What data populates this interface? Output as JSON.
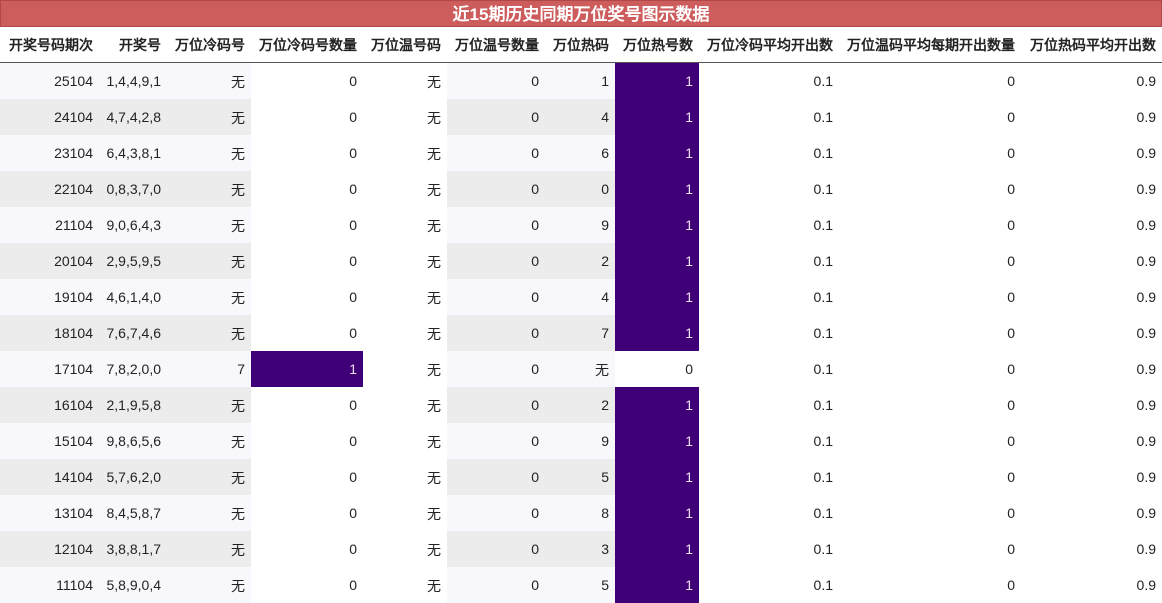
{
  "title": "近15期历史同期万位奖号图示数据",
  "colors": {
    "title_bg": "#cd5c5c",
    "highlight": "#3f0077"
  },
  "columns": [
    "开奖号码期次",
    "开奖号",
    "万位冷码号",
    "万位冷码号数量",
    "万位温号码",
    "万位温号数量",
    "万位热码",
    "万位热号数",
    "万位冷码平均开出数",
    "万位温码平均每期开出数量",
    "万位热码平均开出数"
  ],
  "rows": [
    {
      "issue": "25104",
      "numbers": "1,4,4,9,1",
      "cold": "无",
      "cold_count": "0",
      "warm": "无",
      "warm_count": "0",
      "hot": "1",
      "hot_count": "1",
      "cold_avg": "0.1",
      "warm_avg": "0",
      "hot_avg": "0.9"
    },
    {
      "issue": "24104",
      "numbers": "4,7,4,2,8",
      "cold": "无",
      "cold_count": "0",
      "warm": "无",
      "warm_count": "0",
      "hot": "4",
      "hot_count": "1",
      "cold_avg": "0.1",
      "warm_avg": "0",
      "hot_avg": "0.9"
    },
    {
      "issue": "23104",
      "numbers": "6,4,3,8,1",
      "cold": "无",
      "cold_count": "0",
      "warm": "无",
      "warm_count": "0",
      "hot": "6",
      "hot_count": "1",
      "cold_avg": "0.1",
      "warm_avg": "0",
      "hot_avg": "0.9"
    },
    {
      "issue": "22104",
      "numbers": "0,8,3,7,0",
      "cold": "无",
      "cold_count": "0",
      "warm": "无",
      "warm_count": "0",
      "hot": "0",
      "hot_count": "1",
      "cold_avg": "0.1",
      "warm_avg": "0",
      "hot_avg": "0.9"
    },
    {
      "issue": "21104",
      "numbers": "9,0,6,4,3",
      "cold": "无",
      "cold_count": "0",
      "warm": "无",
      "warm_count": "0",
      "hot": "9",
      "hot_count": "1",
      "cold_avg": "0.1",
      "warm_avg": "0",
      "hot_avg": "0.9"
    },
    {
      "issue": "20104",
      "numbers": "2,9,5,9,5",
      "cold": "无",
      "cold_count": "0",
      "warm": "无",
      "warm_count": "0",
      "hot": "2",
      "hot_count": "1",
      "cold_avg": "0.1",
      "warm_avg": "0",
      "hot_avg": "0.9"
    },
    {
      "issue": "19104",
      "numbers": "4,6,1,4,0",
      "cold": "无",
      "cold_count": "0",
      "warm": "无",
      "warm_count": "0",
      "hot": "4",
      "hot_count": "1",
      "cold_avg": "0.1",
      "warm_avg": "0",
      "hot_avg": "0.9"
    },
    {
      "issue": "18104",
      "numbers": "7,6,7,4,6",
      "cold": "无",
      "cold_count": "0",
      "warm": "无",
      "warm_count": "0",
      "hot": "7",
      "hot_count": "1",
      "cold_avg": "0.1",
      "warm_avg": "0",
      "hot_avg": "0.9"
    },
    {
      "issue": "17104",
      "numbers": "7,8,2,0,0",
      "cold": "7",
      "cold_count": "1",
      "warm": "无",
      "warm_count": "0",
      "hot": "无",
      "hot_count": "0",
      "cold_avg": "0.1",
      "warm_avg": "0",
      "hot_avg": "0.9"
    },
    {
      "issue": "16104",
      "numbers": "2,1,9,5,8",
      "cold": "无",
      "cold_count": "0",
      "warm": "无",
      "warm_count": "0",
      "hot": "2",
      "hot_count": "1",
      "cold_avg": "0.1",
      "warm_avg": "0",
      "hot_avg": "0.9"
    },
    {
      "issue": "15104",
      "numbers": "9,8,6,5,6",
      "cold": "无",
      "cold_count": "0",
      "warm": "无",
      "warm_count": "0",
      "hot": "9",
      "hot_count": "1",
      "cold_avg": "0.1",
      "warm_avg": "0",
      "hot_avg": "0.9"
    },
    {
      "issue": "14104",
      "numbers": "5,7,6,2,0",
      "cold": "无",
      "cold_count": "0",
      "warm": "无",
      "warm_count": "0",
      "hot": "5",
      "hot_count": "1",
      "cold_avg": "0.1",
      "warm_avg": "0",
      "hot_avg": "0.9"
    },
    {
      "issue": "13104",
      "numbers": "8,4,5,8,7",
      "cold": "无",
      "cold_count": "0",
      "warm": "无",
      "warm_count": "0",
      "hot": "8",
      "hot_count": "1",
      "cold_avg": "0.1",
      "warm_avg": "0",
      "hot_avg": "0.9"
    },
    {
      "issue": "12104",
      "numbers": "3,8,8,1,7",
      "cold": "无",
      "cold_count": "0",
      "warm": "无",
      "warm_count": "0",
      "hot": "3",
      "hot_count": "1",
      "cold_avg": "0.1",
      "warm_avg": "0",
      "hot_avg": "0.9"
    },
    {
      "issue": "11104",
      "numbers": "5,8,9,0,4",
      "cold": "无",
      "cold_count": "0",
      "warm": "无",
      "warm_count": "0",
      "hot": "5",
      "hot_count": "1",
      "cold_avg": "0.1",
      "warm_avg": "0",
      "hot_avg": "0.9"
    }
  ]
}
